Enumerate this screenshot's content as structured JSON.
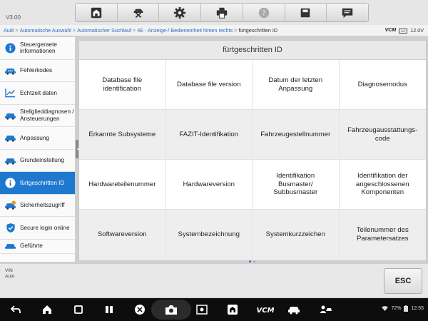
{
  "app": {
    "version": "V3.00"
  },
  "toolbar": {
    "icons": [
      "home-icon",
      "vehicle-lift-icon",
      "gear-icon",
      "printer-icon",
      "help-icon",
      "save-icon",
      "chat-icon"
    ]
  },
  "breadcrumb": {
    "items": [
      "Audi",
      "Automatische Auswahl",
      "Automatischer Suchlauf",
      "4E - Anzeige-/ Bedieneinheit hinten rechts"
    ],
    "current": "fürtgeschritten ID",
    "separator": ">"
  },
  "status": {
    "vcm": "VCM",
    "voltage": "12.0V"
  },
  "sidebar": {
    "items": [
      {
        "label": "Steuergeraete informationen",
        "icon": "info-icon",
        "active": false
      },
      {
        "label": "Fehlerkodes",
        "icon": "car-dtc-icon",
        "active": false
      },
      {
        "label": "Echtzeit daten",
        "icon": "line-chart-icon",
        "active": false
      },
      {
        "label": "Stellglieddiagnosen / Ansteuerungen",
        "icon": "car-actuator-icon",
        "active": false
      },
      {
        "label": "Anpassung",
        "icon": "car-adapt-icon",
        "active": false
      },
      {
        "label": "Grundeinstellung",
        "icon": "car-basic-icon",
        "active": false
      },
      {
        "label": "fürtgeschritten ID",
        "icon": "info-icon",
        "active": true
      },
      {
        "label": "Sicherheitszugriff",
        "icon": "car-security-icon",
        "active": false
      },
      {
        "label": "Secure login online",
        "icon": "shield-icon",
        "active": false
      },
      {
        "label": "Geführte",
        "icon": "car-guided-icon",
        "active": false
      }
    ]
  },
  "main": {
    "title": "fürtgeschritten ID",
    "cells": [
      "Database file identification",
      "Database file version",
      "Datum der letzten Anpassung",
      "Diagnosemodus",
      "Erkannte Subsysteme",
      "FAZIT-Identifikation",
      "Fahrzeugestellnummer",
      "Fahrzeugausstattungs-code",
      "Hardwareteilenummer",
      "Hardwareversion",
      "Identifikation Busmaster/ Subbusmaster",
      "Identifikation der angeschlossenen Komponenten",
      "Softwareversion",
      "Systembezeichnung",
      "Systemkurzzeichen",
      "Teilenummer des Parametersatzes"
    ]
  },
  "bottom": {
    "vin_label": "VIN",
    "vin_value": "Auto",
    "esc_label": "ESC"
  },
  "navbar": {
    "battery_text": "72%",
    "time": "12:55"
  },
  "colors": {
    "accent": "#1e78d0",
    "link": "#2a6fbf"
  }
}
